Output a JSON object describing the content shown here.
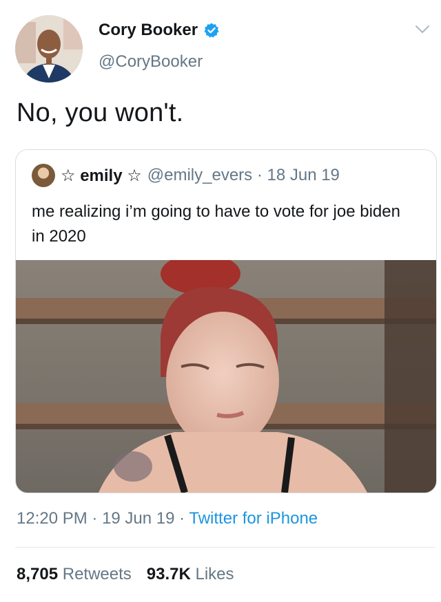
{
  "tweet": {
    "author": {
      "name": "Cory Booker",
      "handle": "@CoryBooker",
      "verified": true
    },
    "text": "No, you won't.",
    "quoted": {
      "display_name": "emily",
      "decoration": "☆",
      "handle": "@emily_evers",
      "date": "18 Jun 19",
      "separator": " · ",
      "text": "me realizing i’m going to have to vote for joe biden in 2020"
    },
    "time": "12:20 PM",
    "date": "19 Jun 19",
    "source": "Twitter for iPhone",
    "dot": " · ",
    "retweets_count": "8,705",
    "retweets_label": "Retweets",
    "likes_count": "93.7K",
    "likes_label": "Likes"
  },
  "icons": {
    "verified": "verified-badge-icon",
    "caret": "chevron-down-icon"
  },
  "colors": {
    "text": "#14171a",
    "secondary": "#657786",
    "link": "#1b95e0",
    "verified": "#1da1f2"
  }
}
